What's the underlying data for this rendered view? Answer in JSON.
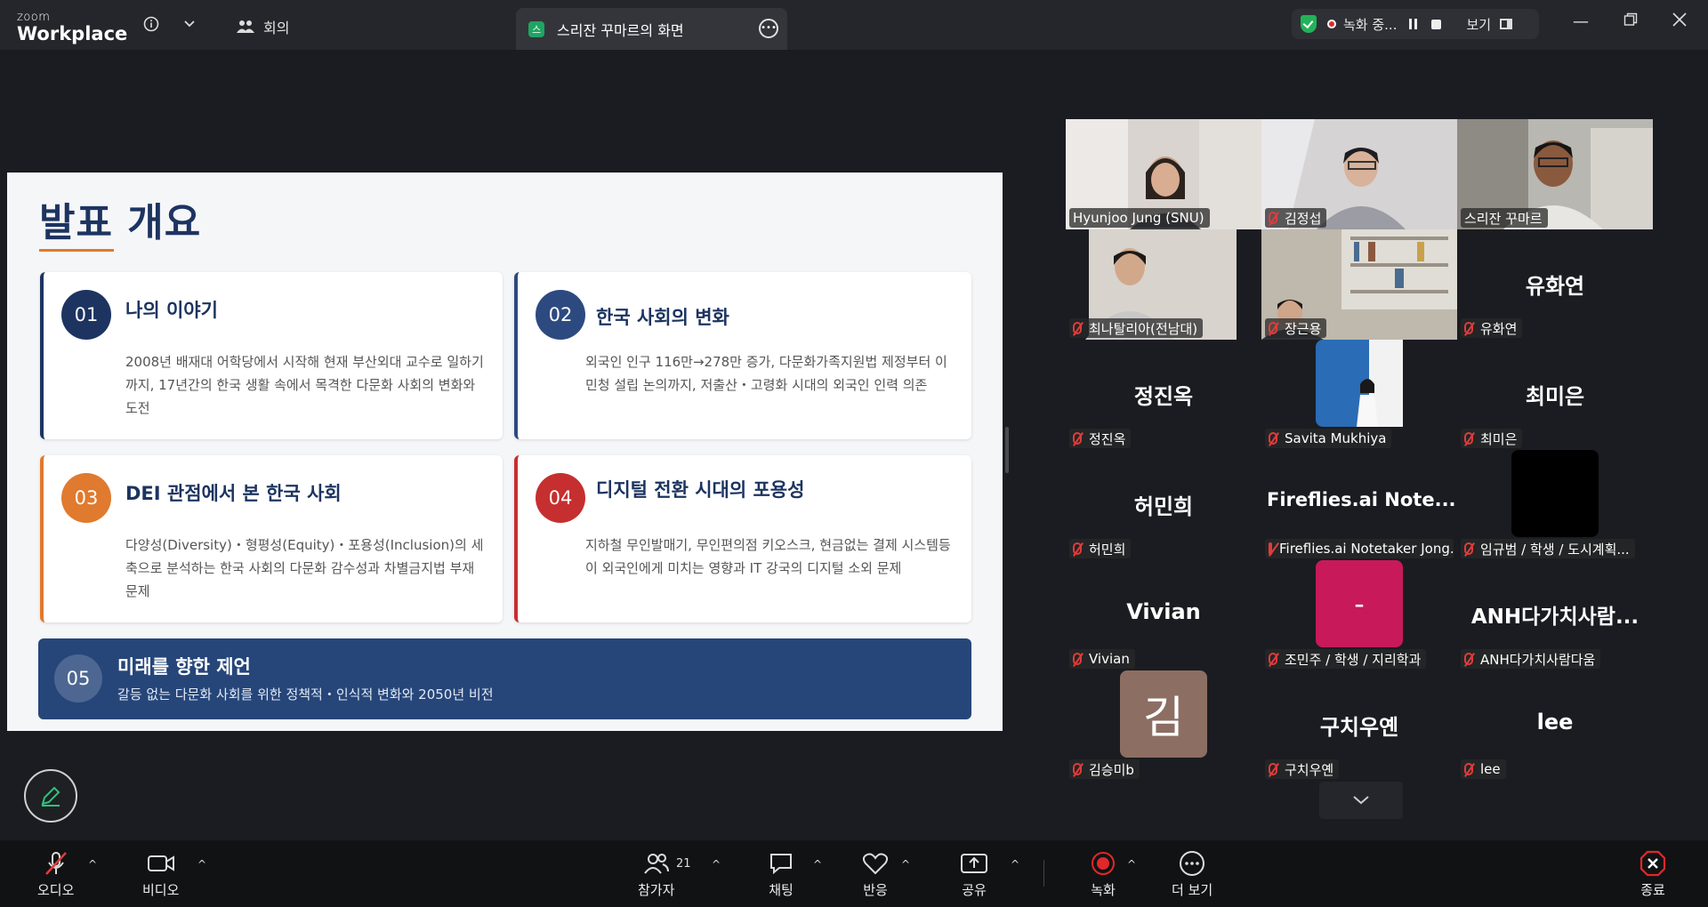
{
  "app": {
    "brand_top": "zoom",
    "brand_bottom": "Workplace",
    "meeting_label": "회의"
  },
  "share_tab": {
    "title": "스리잔 꾸마르의 화면"
  },
  "recording": {
    "label": "녹화 중...",
    "view_label": "보기"
  },
  "slide": {
    "title": "발표 개요",
    "cards": [
      {
        "num": "01",
        "title": "나의 이야기",
        "desc": "2008년 배재대 어학당에서 시작해 현재 부산외대 교수로 일하기까지, 17년간의 한국 생활 속에서 목격한 다문화 사회의 변화와 도전",
        "color": "#1d3461"
      },
      {
        "num": "02",
        "title": "한국 사회의 변화",
        "desc": "외국인 인구 116만→278만 증가, 다문화가족지원법 제정부터 이민청 설립 논의까지, 저출산・고령화 시대의 외국인 인력 의존",
        "color": "#2d4a80"
      },
      {
        "num": "03",
        "title": "DEI 관점에서 본 한국 사회",
        "desc": "다양성(Diversity)・형평성(Equity)・포용성(Inclusion)의 세 축으로 분석하는 한국 사회의 다문화 감수성과 차별금지법 부재 문제",
        "color": "#e07a2e"
      },
      {
        "num": "04",
        "title": "디지털 전환 시대의 포용성",
        "desc": "지하철 무인발매기, 무인편의점 키오스크, 현금없는 결제 시스템등이 외국인에게 미치는 영향과 IT 강국의 디지털 소외 문제",
        "color": "#c62f2f"
      }
    ],
    "bottom": {
      "num": "05",
      "title": "미래를 향한 제언",
      "desc": "갈등 없는 다문화 사회를 위한 정책적・인식적 변화와 2050년 비전"
    }
  },
  "participants": [
    {
      "name": "Hyunjoo Jung (SNU)",
      "muted": false,
      "type": "video"
    },
    {
      "name": "김정섭",
      "muted": true,
      "type": "video"
    },
    {
      "name": "스리잔 꾸마르",
      "muted": false,
      "type": "video",
      "active": true
    },
    {
      "name": "최나탈리아(전남대)",
      "muted": true,
      "type": "video"
    },
    {
      "name": "장근용",
      "muted": true,
      "type": "video"
    },
    {
      "name": "유화연",
      "big": "유화연",
      "muted": true,
      "type": "name"
    },
    {
      "name": "정진옥",
      "big": "정진옥",
      "muted": true,
      "type": "name"
    },
    {
      "name": "Savita Mukhiya",
      "muted": true,
      "type": "avatar-photo"
    },
    {
      "name": "최미은",
      "big": "최미은",
      "muted": true,
      "type": "name"
    },
    {
      "name": "허민희",
      "big": "허민희",
      "muted": true,
      "type": "name"
    },
    {
      "name": "Fireflies.ai Notetaker Jong...",
      "big": "Fireflies.ai  Note...",
      "muted": true,
      "type": "name"
    },
    {
      "name": "임규범 / 학생 / 도시계획...",
      "muted": true,
      "type": "avatar-black"
    },
    {
      "name": "Vivian",
      "big": "Vivian",
      "muted": true,
      "type": "name"
    },
    {
      "name": "조민주 / 학생 / 지리학과",
      "muted": true,
      "type": "avatar-pink",
      "avatar_text": "-"
    },
    {
      "name": "ANH다가치사람다움",
      "big": "ANH다가치사람...",
      "muted": true,
      "type": "name"
    },
    {
      "name": "김승미b",
      "muted": true,
      "type": "avatar-brown",
      "avatar_text": "김"
    },
    {
      "name": "구치우옌",
      "big": "구치우옌",
      "muted": true,
      "type": "name"
    },
    {
      "name": "lee",
      "big": "lee",
      "muted": true,
      "type": "name"
    }
  ],
  "toolbar": {
    "audio": "오디오",
    "video": "비디오",
    "participants": "참가자",
    "participants_count": "21",
    "chat": "채팅",
    "react": "반응",
    "share": "공유",
    "record": "녹화",
    "more": "더 보기",
    "end": "종료"
  }
}
